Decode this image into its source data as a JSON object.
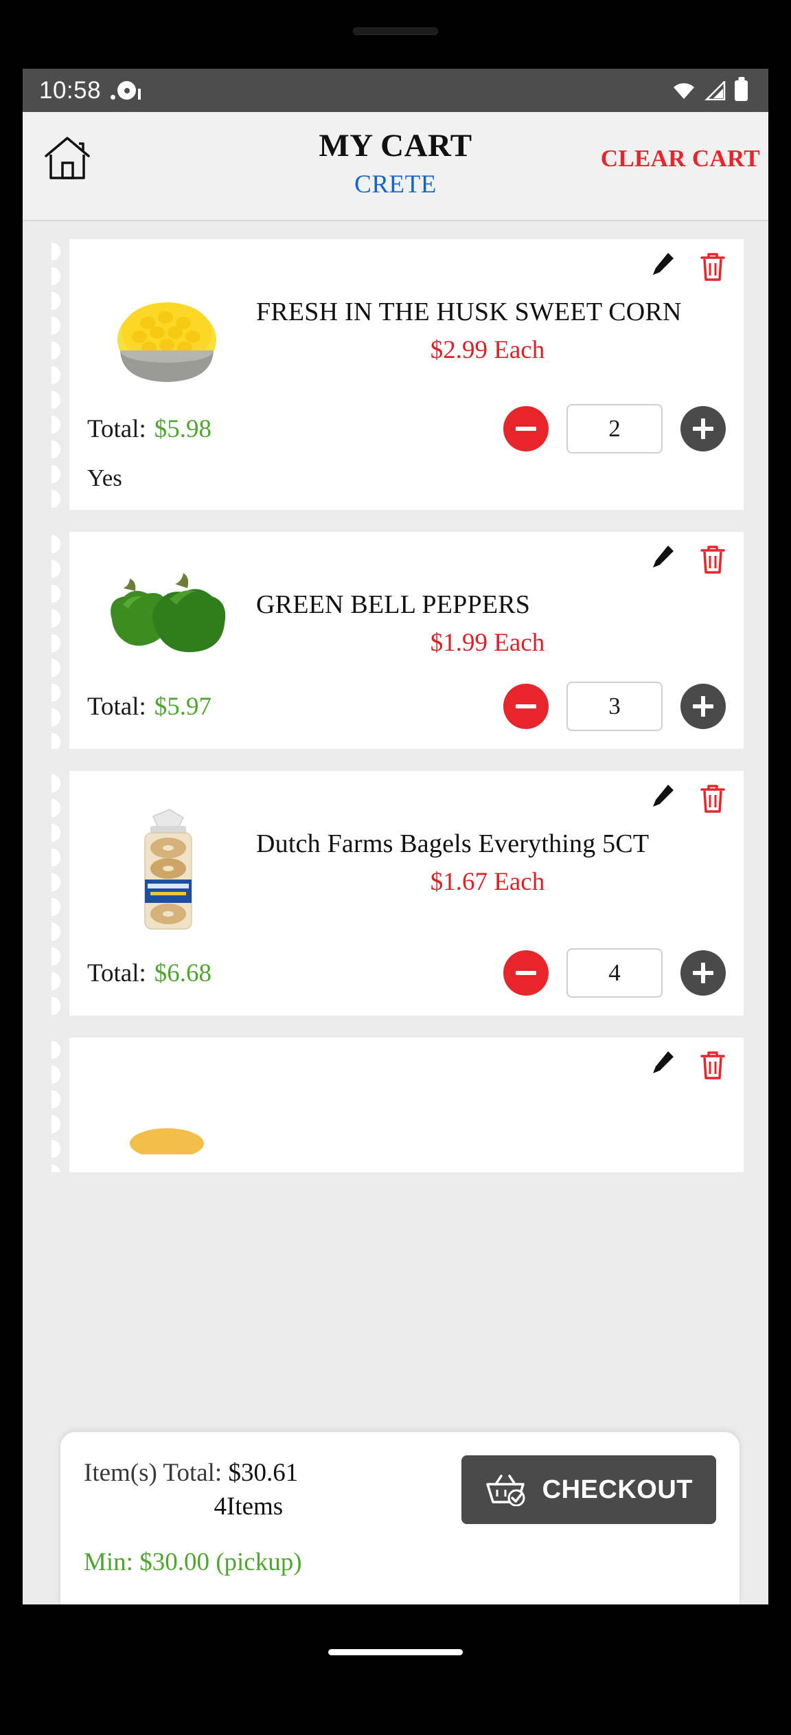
{
  "status_bar": {
    "time": "10:58",
    "icons": [
      "notification-dot-icon",
      "wifi-icon",
      "signal-icon",
      "battery-icon"
    ]
  },
  "header": {
    "home_icon": "home-icon",
    "title": "MY CART",
    "subtitle": "CRETE",
    "clear_cart_label": "CLEAR CART"
  },
  "colors": {
    "accent_red": "#e8252a",
    "price_red": "#e02026",
    "total_green": "#4ca72c",
    "link_blue": "#1565c8",
    "dark_gray": "#4a4a4a"
  },
  "cart_items": [
    {
      "name": "FRESH IN THE HUSK SWEET CORN",
      "unit_price": "$2.99 Each",
      "total_label": "Total:",
      "total_value": "$5.98",
      "quantity": "2",
      "note": "Yes",
      "image": "sweet-corn-bowl"
    },
    {
      "name": "GREEN BELL PEPPERS",
      "unit_price": "$1.99 Each",
      "total_label": "Total:",
      "total_value": "$5.97",
      "quantity": "3",
      "note": "",
      "image": "green-bell-peppers"
    },
    {
      "name": "Dutch Farms Bagels Everything 5CT",
      "unit_price": "$1.67 Each",
      "total_label": "Total:",
      "total_value": "$6.68",
      "quantity": "4",
      "note": "",
      "image": "bagels-package"
    }
  ],
  "summary": {
    "items_total_label": "Item(s) Total:",
    "items_total_value": "$30.61",
    "items_count": "4Items",
    "checkout_label": "CHECKOUT",
    "checkout_icon": "shopping-basket-check-icon",
    "minimum_line": "Min: $30.00 (pickup)"
  }
}
